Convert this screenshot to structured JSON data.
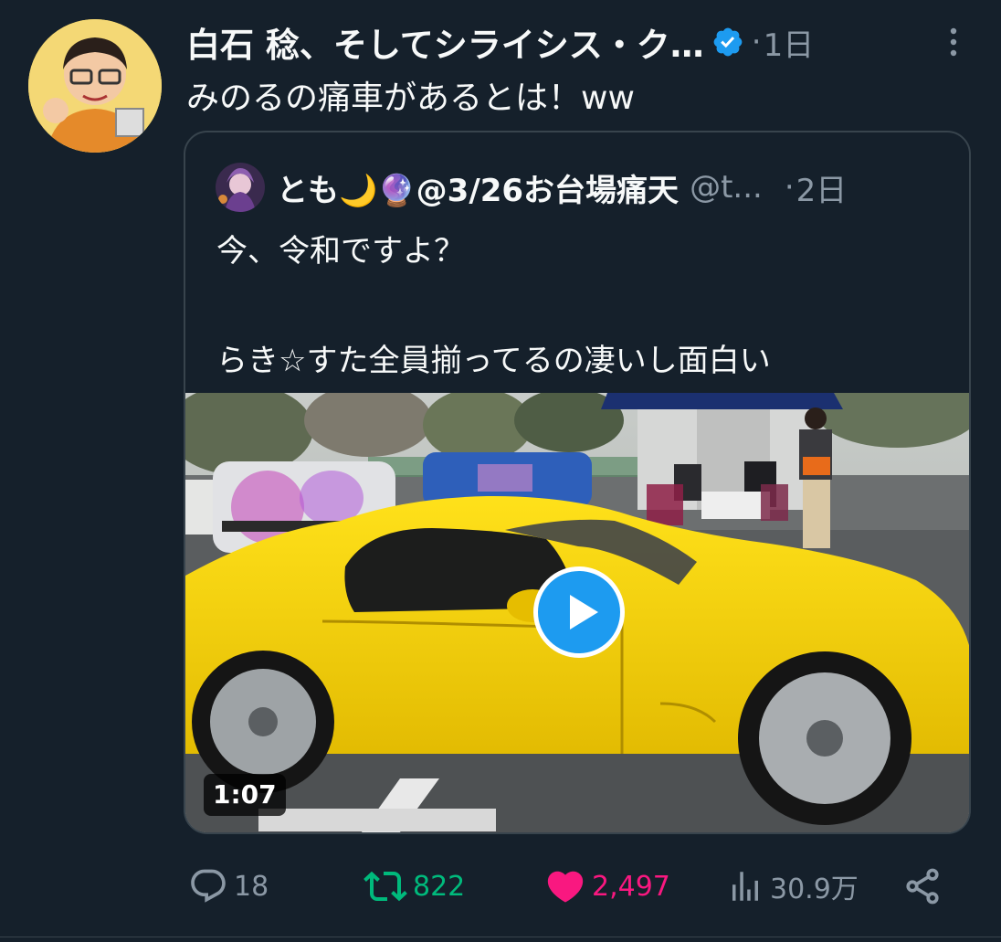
{
  "tweet": {
    "author_name": "白石 稔、そしてシライシス・ク…",
    "dot": "·",
    "time": "1日",
    "text": "みのるの痛車があるとは！ww"
  },
  "quote": {
    "author_name": "とも🌙🔮@3/26お台場痛天",
    "handle": "@t...",
    "dot": "·",
    "time": "2日",
    "text": "今、令和ですよ？\n\nらき☆すた全員揃ってるの凄いし面白い",
    "video_duration": "1:07"
  },
  "actions": {
    "replies": "18",
    "retweets": "822",
    "likes": "2,497",
    "views": "30.9万"
  },
  "colors": {
    "background": "#15202b",
    "text": "#f7f9f9",
    "secondary": "#8b98a5",
    "retweet": "#00ba7c",
    "like": "#f91880",
    "accent": "#1d9bf0"
  },
  "icons": {
    "verified": "verified-badge-icon",
    "more": "more-options-icon",
    "reply": "reply-icon",
    "retweet": "retweet-icon",
    "like": "heart-icon",
    "views": "views-icon",
    "share": "share-icon",
    "play": "play-icon"
  }
}
